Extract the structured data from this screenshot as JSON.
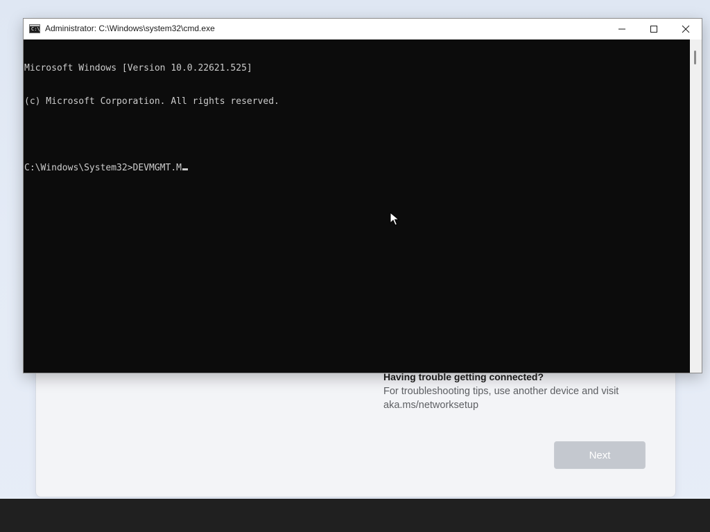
{
  "setup": {
    "help_title": "Having trouble getting connected?",
    "help_body": "For troubleshooting tips, use another device and visit aka.ms/networksetup",
    "next_label": "Next"
  },
  "cmd": {
    "title": "Administrator: C:\\Windows\\system32\\cmd.exe",
    "icon_label": "C:\\",
    "lines": [
      "Microsoft Windows [Version 10.0.22621.525]",
      "(c) Microsoft Corporation. All rights reserved.",
      "",
      "C:\\Windows\\System32>DEVMGMT.M"
    ],
    "controls": {
      "minimize": "minimize-icon",
      "maximize": "maximize-icon",
      "close": "close-icon"
    }
  },
  "colors": {
    "console_bg": "#0c0c0c",
    "console_text": "#cccccc",
    "button_disabled": "#c4c8cf",
    "taskbar": "#202020"
  }
}
